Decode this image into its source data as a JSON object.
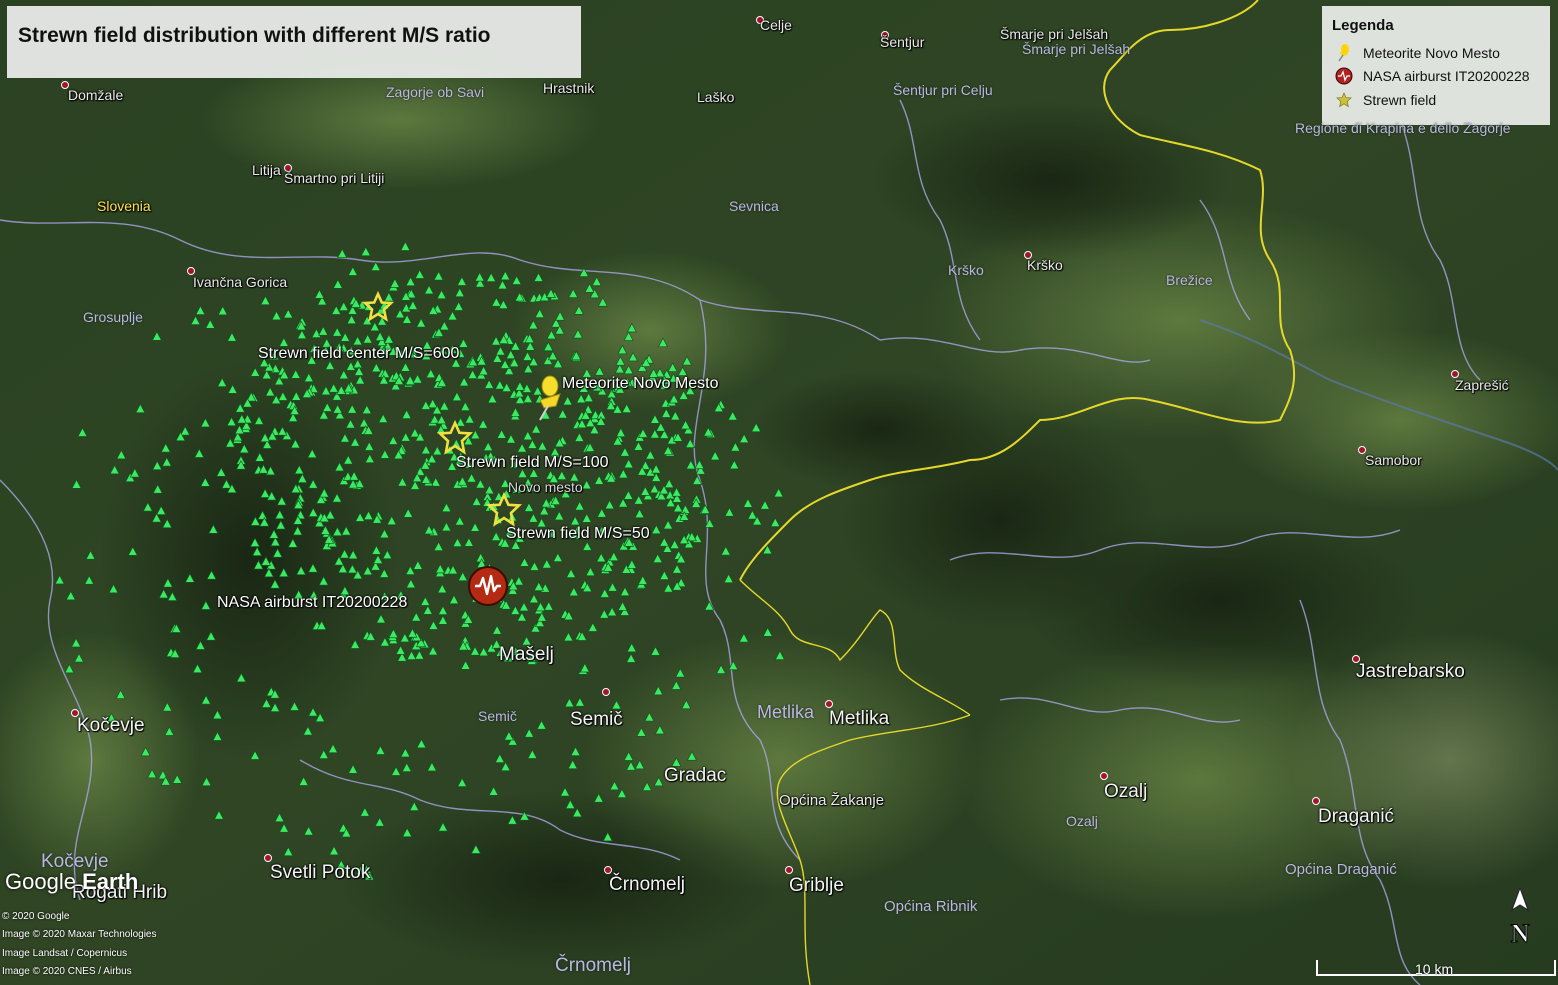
{
  "title": "Strewn field distribution with different M/S ratio",
  "legend": {
    "title": "Legenda",
    "items": [
      {
        "label": "Meteorite Novo Mesto",
        "icon": "yellow-pushpin-icon",
        "color": "#ffd400"
      },
      {
        "label": "NASA airburst IT20200228",
        "icon": "red-circle-icon",
        "color": "#b22222"
      },
      {
        "label": "Strewn field",
        "icon": "star-icon",
        "color": "#cbbf3e"
      }
    ]
  },
  "annotations": {
    "strewn_center": "Strewn field center M/S=600",
    "meteorite": "Meteorite Novo Mesto",
    "strewn_100": "Strewn field M/S=100",
    "strewn_50": "Strewn field M/S=50",
    "nasa_airburst": "NASA airburst IT20200228"
  },
  "places": {
    "domzale": "Domžale",
    "zagorje": "Zagorje ob Savi",
    "hrastnik": "Hrastnik",
    "lasko": "Laško",
    "celje": "Celje",
    "sentjur": "Šentjur",
    "smarje1": "Šmarje pri Jelšah",
    "smarje2": "Šmarje pri Jelšah",
    "sentjur_celju": "Šentjur pri Celju",
    "litija": "Litija",
    "smartno": "Šmartno pri Litiji",
    "slovenia": "Slovenia",
    "sevnica": "Sevnica",
    "ivancna": "Ivančna Gorica",
    "grosuplje": "Grosuplje",
    "krsko1": "Krško",
    "krsko2": "Krško",
    "brezice": "Brežice",
    "regione": "Regione di Krapina e dello Zagorje",
    "zapresic": "Zaprešić",
    "samobor": "Samobor",
    "maselj": "Mašelj",
    "semic1": "Semič",
    "semic2": "Semič",
    "metlika1": "Metlika",
    "metlika2": "Metlika",
    "gradac": "Gradac",
    "jastrebarsko": "Jastrebarsko",
    "kocevje1": "Kočevje",
    "kocevje2": "Kočevje",
    "opcina_zakanje": "Općina Žakanje",
    "ozalj1": "Ozalj",
    "ozalj2": "Ozalj",
    "draganic": "Draganić",
    "opcina_draganic": "Općina Draganić",
    "svetli_potok": "Svetli Potok",
    "rogati_hrib": "Rogati Hrib",
    "crnomelj1": "Črnomelj",
    "crnomelj2": "Črnomelj",
    "griblje": "Griblje",
    "opcina_ribnik": "Općina Ribnik",
    "novo_mesto": "Novo mesto"
  },
  "attribution": [
    "© 2020 Google",
    "Image © 2020 Maxar Technologies",
    "Image Landsat / Copernicus",
    "Image © 2020 CNES / Airbus"
  ],
  "logo": {
    "google": "Google",
    "earth": "Earth"
  },
  "scale_bar": "10 km",
  "north_label": "N",
  "colors": {
    "terrain_dark": "#24381c",
    "terrain_light": "#5a7a3a",
    "marker_green": "#38e058",
    "border_yellow": "#e6d82a",
    "admin_border": "#a9a6e6"
  }
}
